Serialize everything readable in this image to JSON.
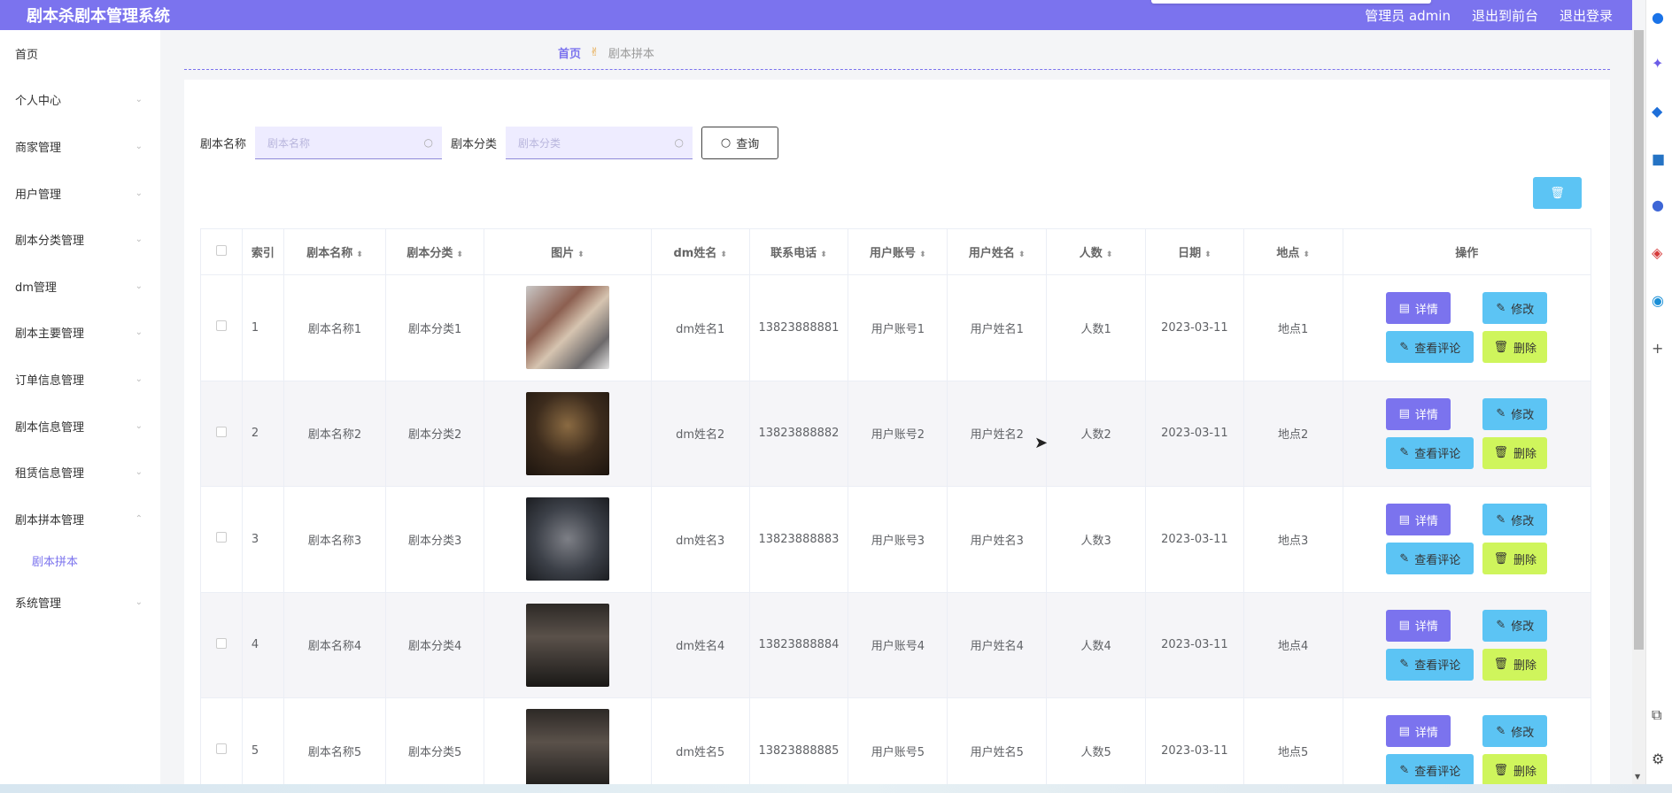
{
  "header": {
    "title": "剧本杀剧本管理系统",
    "user": "管理员 admin",
    "to_front": "退出到前台",
    "logout": "退出登录"
  },
  "sidebar": {
    "items": [
      {
        "label": "首页",
        "chev": ""
      },
      {
        "label": "个人中心",
        "chev": "⌄"
      },
      {
        "label": "商家管理",
        "chev": "⌄"
      },
      {
        "label": "用户管理",
        "chev": "⌄"
      },
      {
        "label": "剧本分类管理",
        "chev": "⌄"
      },
      {
        "label": "dm管理",
        "chev": "⌄"
      },
      {
        "label": "剧本主要管理",
        "chev": "⌄"
      },
      {
        "label": "订单信息管理",
        "chev": "⌄"
      },
      {
        "label": "剧本信息管理",
        "chev": "⌄"
      },
      {
        "label": "租赁信息管理",
        "chev": "⌄"
      },
      {
        "label": "剧本拼本管理",
        "chev": "⌃"
      }
    ],
    "sub_item": "剧本拼本",
    "last_item": {
      "label": "系统管理",
      "chev": "⌄"
    }
  },
  "breadcrumb": {
    "home": "首页",
    "current": "剧本拼本"
  },
  "search": {
    "name_label": "剧本名称",
    "name_placeholder": "剧本名称",
    "cat_label": "剧本分类",
    "cat_placeholder": "剧本分类",
    "query": "查询"
  },
  "table": {
    "headers": {
      "index": "索引",
      "name": "剧本名称",
      "cat": "剧本分类",
      "img": "图片",
      "dm": "dm姓名",
      "phone": "联系电话",
      "account": "用户账号",
      "uname": "用户姓名",
      "people": "人数",
      "date": "日期",
      "place": "地点",
      "ops": "操作"
    },
    "rows": [
      {
        "index": "1",
        "name": "剧本名称1",
        "cat": "剧本分类1",
        "dm": "dm姓名1",
        "phone": "13823888881",
        "account": "用户账号1",
        "uname": "用户姓名1",
        "people": "人数1",
        "date": "2023-03-11",
        "place": "地点1"
      },
      {
        "index": "2",
        "name": "剧本名称2",
        "cat": "剧本分类2",
        "dm": "dm姓名2",
        "phone": "13823888882",
        "account": "用户账号2",
        "uname": "用户姓名2",
        "people": "人数2",
        "date": "2023-03-11",
        "place": "地点2"
      },
      {
        "index": "3",
        "name": "剧本名称3",
        "cat": "剧本分类3",
        "dm": "dm姓名3",
        "phone": "13823888883",
        "account": "用户账号3",
        "uname": "用户姓名3",
        "people": "人数3",
        "date": "2023-03-11",
        "place": "地点3"
      },
      {
        "index": "4",
        "name": "剧本名称4",
        "cat": "剧本分类4",
        "dm": "dm姓名4",
        "phone": "13823888884",
        "account": "用户账号4",
        "uname": "用户姓名4",
        "people": "人数4",
        "date": "2023-03-11",
        "place": "地点4"
      },
      {
        "index": "5",
        "name": "剧本名称5",
        "cat": "剧本分类5",
        "dm": "dm姓名5",
        "phone": "13823888885",
        "account": "用户账号5",
        "uname": "用户姓名5",
        "people": "人数5",
        "date": "2023-03-11",
        "place": "地点5"
      }
    ],
    "buttons": {
      "detail": "详情",
      "edit": "修改",
      "comment": "查看评论",
      "delete": "删除"
    }
  },
  "colors": {
    "primary": "#7b73ee",
    "info": "#5cc4f4",
    "danger_light": "#cff55c"
  }
}
